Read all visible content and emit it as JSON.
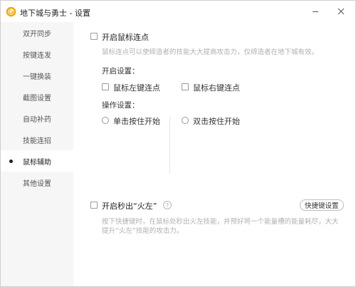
{
  "window": {
    "title": "地下城与勇士 - 设置"
  },
  "sidebar": {
    "items": [
      {
        "label": "双开同步"
      },
      {
        "label": "按键连发"
      },
      {
        "label": "一键换装"
      },
      {
        "label": "截图设置"
      },
      {
        "label": "自动补药"
      },
      {
        "label": "技能连招"
      },
      {
        "label": "鼠标辅助",
        "active": true
      },
      {
        "label": "其他设置"
      }
    ]
  },
  "mouse_assist": {
    "enable_label": "开启鼠标连点",
    "description": "鼠标连点可以使缔造者的技能大大提高攻击力，仅缔造者在地下城有效。",
    "settings_title": "开启设置：",
    "left_click_label": "鼠标左键连点",
    "right_click_label": "鼠标右键连点",
    "operation_title": "操作设置：",
    "single_click_label": "单击按住开始",
    "double_click_label": "双击按住开始"
  },
  "flame": {
    "enable_label": "开启秒出“火左”",
    "help_symbol": "?",
    "hotkey_button": "快捷键设置",
    "description": "按下快捷键时，在鼠标处秒出火左技能，并预好将一个能量槽的能量耗尽，大大提升“火左”技能的攻击力。"
  },
  "colors": {
    "sidebar_bg": "#f6f6f6",
    "logo": "#f0a800"
  },
  "icons": {
    "logo": "game-logo-icon",
    "minimize": "minimize-icon",
    "close": "close-icon"
  }
}
